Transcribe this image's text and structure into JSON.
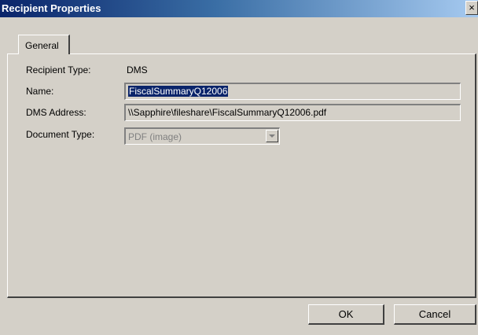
{
  "window": {
    "title": "Recipient Properties",
    "close_glyph": "×"
  },
  "tabs": [
    {
      "label": "General",
      "active": true
    }
  ],
  "properties": {
    "recipient_type_label": "Recipient Type:",
    "recipient_type_value": "DMS",
    "name_label": "Name:",
    "name_value": "FiscalSummaryQ12006",
    "dms_address_label": "DMS Address:",
    "dms_address_value": "\\\\Sapphire\\fileshare\\FiscalSummaryQ12006.pdf",
    "document_type_label": "Document Type:",
    "document_type_value": "PDF (image)"
  },
  "buttons": {
    "ok_label": "OK",
    "cancel_label": "Cancel"
  },
  "colors": {
    "title_bar_start": "#0a246a",
    "title_bar_end": "#a6caf0",
    "dialog_background": "#d4d0c8",
    "selection_highlight": "#0a246a"
  },
  "icons": {
    "close": "close-icon",
    "dropdown": "chevron-down-icon"
  }
}
